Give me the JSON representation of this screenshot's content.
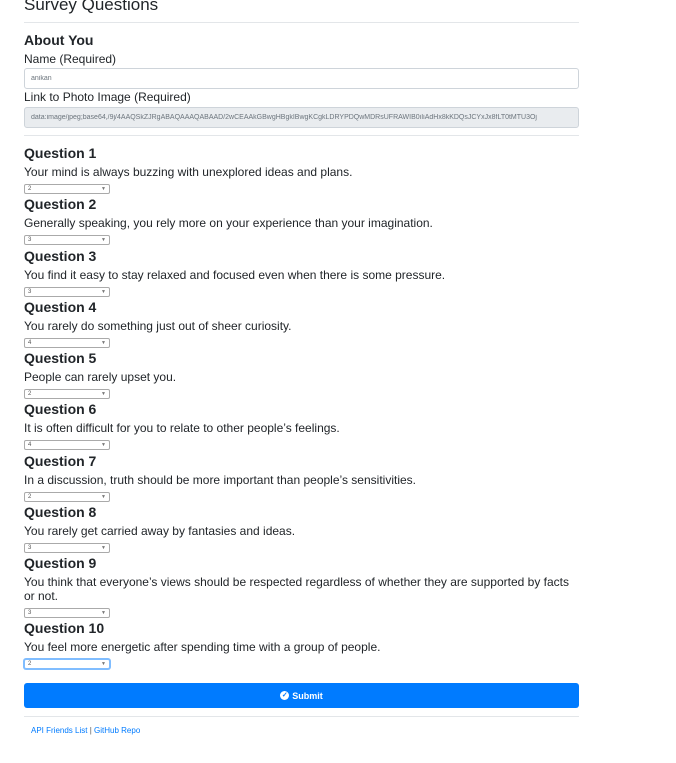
{
  "page_title": "Survey Questions",
  "about": {
    "heading": "About You",
    "name_label": "Name (Required)",
    "name_value": "anikan",
    "photo_label": "Link to Photo Image (Required)",
    "photo_value": "data:image/jpeg;base64,/9j/4AAQSkZJRgABAQAAAQABAAD/2wCEAAkGBwgHBgkIBwgKCgkLDRYPDQwMDRsUFRAWIB0iIiAdHx8kKDQsJCYxJx8fLT0tMTU3Oj"
  },
  "questions": [
    {
      "title": "Question 1",
      "text": "Your mind is always buzzing with unexplored ideas and plans.",
      "value": "2"
    },
    {
      "title": "Question 2",
      "text": "Generally speaking, you rely more on your experience than your imagination.",
      "value": "3"
    },
    {
      "title": "Question 3",
      "text": "You find it easy to stay relaxed and focused even when there is some pressure.",
      "value": "3"
    },
    {
      "title": "Question 4",
      "text": "You rarely do something just out of sheer curiosity.",
      "value": "4"
    },
    {
      "title": "Question 5",
      "text": "People can rarely upset you.",
      "value": "2"
    },
    {
      "title": "Question 6",
      "text": "It is often difficult for you to relate to other people’s feelings.",
      "value": "4"
    },
    {
      "title": "Question 7",
      "text": "In a discussion, truth should be more important than people’s sensitivities.",
      "value": "2"
    },
    {
      "title": "Question 8",
      "text": "You rarely get carried away by fantasies and ideas.",
      "value": "3"
    },
    {
      "title": "Question 9",
      "text": "You think that everyone’s views should be respected regardless of whether they are supported by facts or not.",
      "value": "3"
    },
    {
      "title": "Question 10",
      "text": "You feel more energetic after spending time with a group of people.",
      "value": "2"
    }
  ],
  "submit_label": "Submit",
  "icons": {
    "submit": "check-circle-icon",
    "select": "chevron-down-icon"
  },
  "footer": {
    "link1": "API Friends List",
    "separator": "|",
    "link2": "GitHub Repo"
  },
  "colors": {
    "primary": "#007bff",
    "text": "#212529"
  }
}
